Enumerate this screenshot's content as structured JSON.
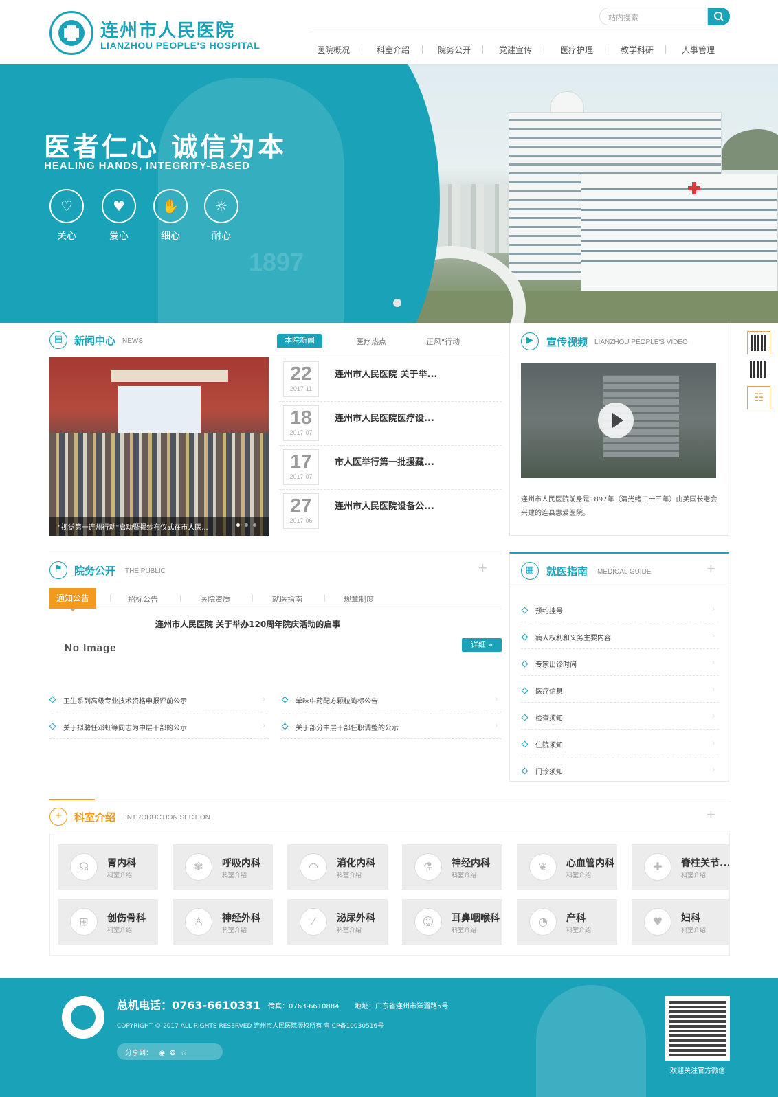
{
  "header": {
    "logo_cn": "连州市人民医院",
    "logo_en": "LIANZHOU PEOPLE'S HOSPITAL",
    "search_placeholder": "站内搜索",
    "nav": [
      "医院概况",
      "科室介绍",
      "院务公开",
      "党建宣传",
      "医疗护理",
      "教学科研",
      "人事管理"
    ]
  },
  "banner": {
    "title": "医者仁心 诚信为本",
    "subtitle": "HEALING HANDS, INTEGRITY-BASED",
    "virtues": [
      {
        "label": "关心",
        "icon": "heart-hand-icon"
      },
      {
        "label": "爱心",
        "icon": "heart-icon"
      },
      {
        "label": "细心",
        "icon": "handshake-icon"
      },
      {
        "label": "耐心",
        "icon": "lightbulb-icon"
      }
    ],
    "watermark_year": "1897"
  },
  "news": {
    "title": "新闻中心",
    "en": "NEWS",
    "tabs": [
      "本院新闻",
      "医疗热点",
      "正风\"行动"
    ],
    "photo_caption": "\"视觉第一连州行动\"启动暨揭纱布仪式在市人医...",
    "items": [
      {
        "day": "22",
        "ym": "2017-11",
        "title": "连州市人民医院 关于举..."
      },
      {
        "day": "18",
        "ym": "2017-07",
        "title": "连州市人民医院医疗设..."
      },
      {
        "day": "17",
        "ym": "2017-07",
        "title": "市人医举行第一批援藏..."
      },
      {
        "day": "27",
        "ym": "2017-06",
        "title": "连州市人民医院设备公..."
      }
    ]
  },
  "video": {
    "title": "宣传视频",
    "en": "LIANZHOU PEOPLE'S VIDEO",
    "desc_line1": "连州市人民医院前身是1897年（清光绪二十三年）由美国长老会",
    "desc_line2": "兴建的连县惠爱医院。"
  },
  "public": {
    "title": "院务公开",
    "en": "THE PUBLIC",
    "tabs": [
      "通知公告",
      "招标公告",
      "医院资质",
      "就医指南",
      "规章制度"
    ],
    "featured_title": "连州市人民医院 关于举办120周年院庆活动的启事",
    "no_image": "No Image",
    "more": "详细",
    "items": [
      "卫生系列高级专业技术资格申报评前公示",
      "单味中药配方颗粒询标公告",
      "关于拟聘任邓虹等同志为中层干部的公示",
      "关于部分中层干部任职调整的公示"
    ]
  },
  "guide": {
    "title": "就医指南",
    "en": "MEDICAL GUIDE",
    "items": [
      "预约挂号",
      "病人权利和义务主要内容",
      "专家出诊时间",
      "医疗信息",
      "检查须知",
      "住院须知",
      "门诊须知"
    ]
  },
  "departments": {
    "title": "科室介绍",
    "en": "INTRODUCTION SECTION",
    "sub_label": "科室介绍",
    "items": [
      {
        "name": "胃内科",
        "icon": "ear-icon"
      },
      {
        "name": "呼吸内科",
        "icon": "lungs-icon"
      },
      {
        "name": "消化内科",
        "icon": "lips-icon"
      },
      {
        "name": "神经内科",
        "icon": "microscope-icon"
      },
      {
        "name": "心血管内科",
        "icon": "heart-vessel-icon"
      },
      {
        "name": "脊柱关节...",
        "icon": "bandage-icon"
      },
      {
        "name": "创伤骨科",
        "icon": "first-aid-kit-icon"
      },
      {
        "name": "神经外科",
        "icon": "person-icon"
      },
      {
        "name": "泌尿外科",
        "icon": "syringe-icon"
      },
      {
        "name": "耳鼻咽喉科",
        "icon": "face-icon"
      },
      {
        "name": "产科",
        "icon": "stomach-icon"
      },
      {
        "name": "妇科",
        "icon": "heartbeat-icon"
      }
    ]
  },
  "footer": {
    "phone": "总机电话：0763-6610331",
    "fax": "传真：0763-6610884",
    "address": "地址：广东省连州市洋湄路5号",
    "copyright": "COPYRIGHT © 2017 ALL RIGHTS RESERVED 连州市人民医院版权所有 粤ICP备10030516号",
    "share": "分享到：",
    "qr_caption": "欢迎关注官方微信"
  },
  "colors": {
    "accent": "#1aa3b8",
    "orange": "#f39a1e"
  }
}
